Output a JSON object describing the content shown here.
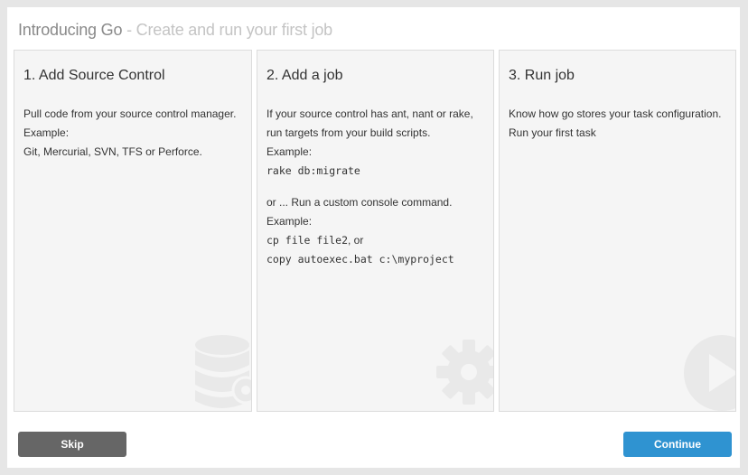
{
  "modal": {
    "title": "Introducing Go",
    "subtitle": " - Create and run your first job"
  },
  "cards": [
    {
      "heading": "1. Add Source Control",
      "lines": [
        "Pull code from your source control manager.",
        "Example:",
        "Git, Mercurial, SVN, TFS or Perforce."
      ],
      "icon": "database-icon"
    },
    {
      "heading": "2. Add a job",
      "text_1": "If your source control has ant, nant or rake, run targets from your build scripts.",
      "example_label_1": "Example:",
      "code_1": "rake db:migrate",
      "text_2": "or ... Run a custom console command.",
      "example_label_2": "Example:",
      "code_2": "cp file file2",
      "code_2_suffix": ", or",
      "code_3": "copy autoexec.bat c:\\myproject",
      "icon": "gear-icon"
    },
    {
      "heading": "3. Run job",
      "lines": [
        "Know how go stores your task configuration.",
        "Run your first task"
      ],
      "icon": "play-icon"
    }
  ],
  "buttons": {
    "skip": "Skip",
    "continue": "Continue"
  },
  "colors": {
    "skip_button": "#666666",
    "continue_button": "#2f93d1",
    "title": "#8a8a8a",
    "subtitle": "#c4c4c4"
  }
}
